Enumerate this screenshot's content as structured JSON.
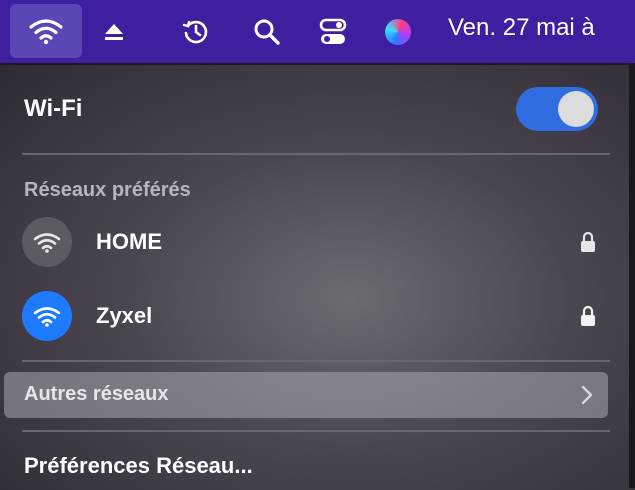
{
  "menubar": {
    "date": "Ven. 27 mai à",
    "icons": [
      "wifi-icon",
      "eject-icon",
      "time-machine-icon",
      "search-icon",
      "control-center-icon",
      "siri-icon"
    ]
  },
  "panel": {
    "title": "Wi-Fi",
    "wifi_enabled": true,
    "section_preferred": "Réseaux préférés",
    "networks": [
      {
        "name": "HOME",
        "connected": false,
        "locked": true
      },
      {
        "name": "Zyxel",
        "connected": true,
        "locked": true
      }
    ],
    "other_networks": "Autres réseaux",
    "preferences": "Préférences Réseau..."
  },
  "colors": {
    "menubar": "#3d1fa0",
    "accent": "#2f6de0",
    "connected": "#1e7bff"
  }
}
